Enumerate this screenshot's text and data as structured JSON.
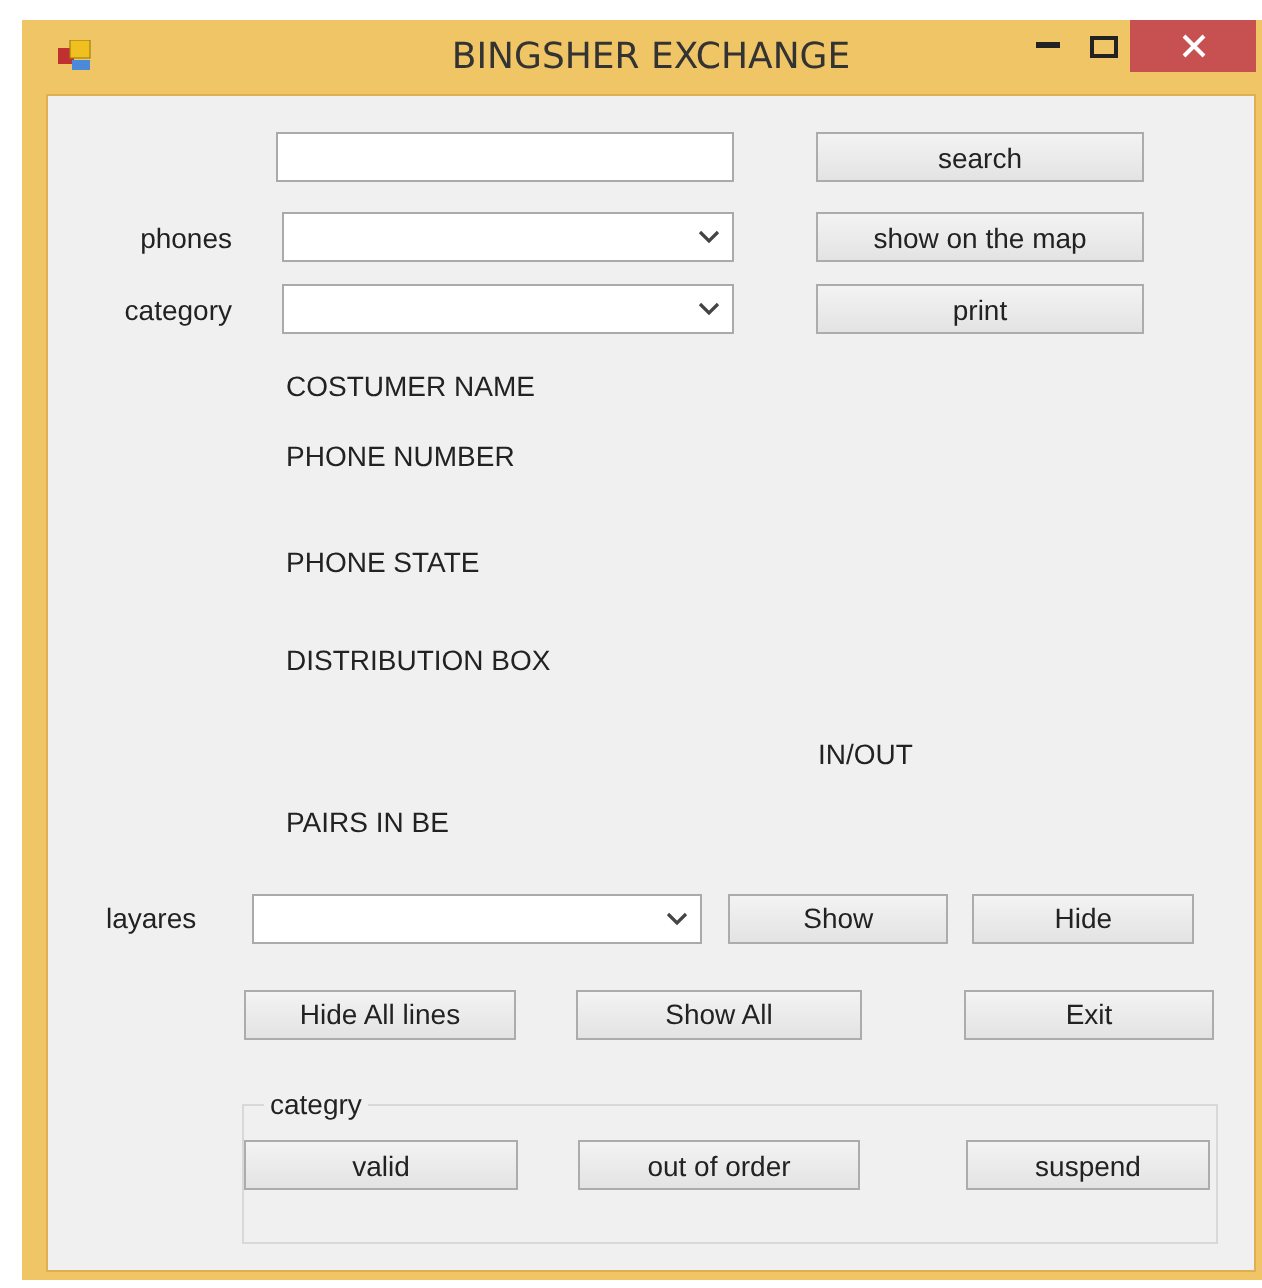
{
  "window": {
    "title": "BINGSHER EXCHANGE"
  },
  "top_buttons": [
    "search",
    "show on the map",
    "print"
  ],
  "field_labels": [
    "phones",
    "category"
  ],
  "info_labels": [
    "COSTUMER NAME",
    "PHONE NUMBER",
    "PHONE STATE",
    "DISTRIBUTION BOX",
    "IN/OUT",
    "PAIRS IN BE"
  ],
  "layers": {
    "label": "layares",
    "buttons": [
      "Show",
      "Hide"
    ]
  },
  "action_buttons": [
    "Hide All lines",
    "Show All",
    "Exit"
  ],
  "category_group": {
    "title": "categry",
    "buttons": [
      "valid",
      "out of order",
      "suspend"
    ]
  }
}
